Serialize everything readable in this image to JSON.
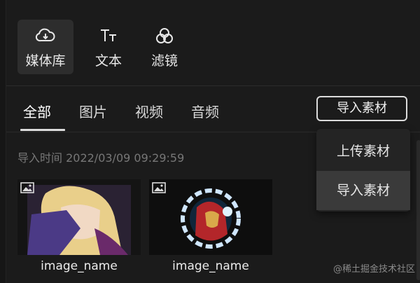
{
  "toolbar": {
    "items": [
      {
        "label": "媒体库",
        "icon": "cloud-download-icon",
        "active": true
      },
      {
        "label": "文本",
        "icon": "text-tt-icon",
        "active": false
      },
      {
        "label": "滤镜",
        "icon": "filter-circles-icon",
        "active": false
      }
    ]
  },
  "tabs": [
    "全部",
    "图片",
    "视频",
    "音频"
  ],
  "import_button": "导入素材",
  "dropdown": {
    "items": [
      "上传素材",
      "导入素材"
    ]
  },
  "section": {
    "timestamp": "导入时间 2022/03/09 09:29:59"
  },
  "media": [
    {
      "name": "image_name",
      "type_icon": "image-icon"
    },
    {
      "name": "image_name",
      "type_icon": "image-icon"
    }
  ],
  "watermark": "@稀土掘金技术社区",
  "colors": {
    "background": "#1b1b1b",
    "active_tool": "#2d2d2d",
    "text": "#e6e6e6"
  }
}
